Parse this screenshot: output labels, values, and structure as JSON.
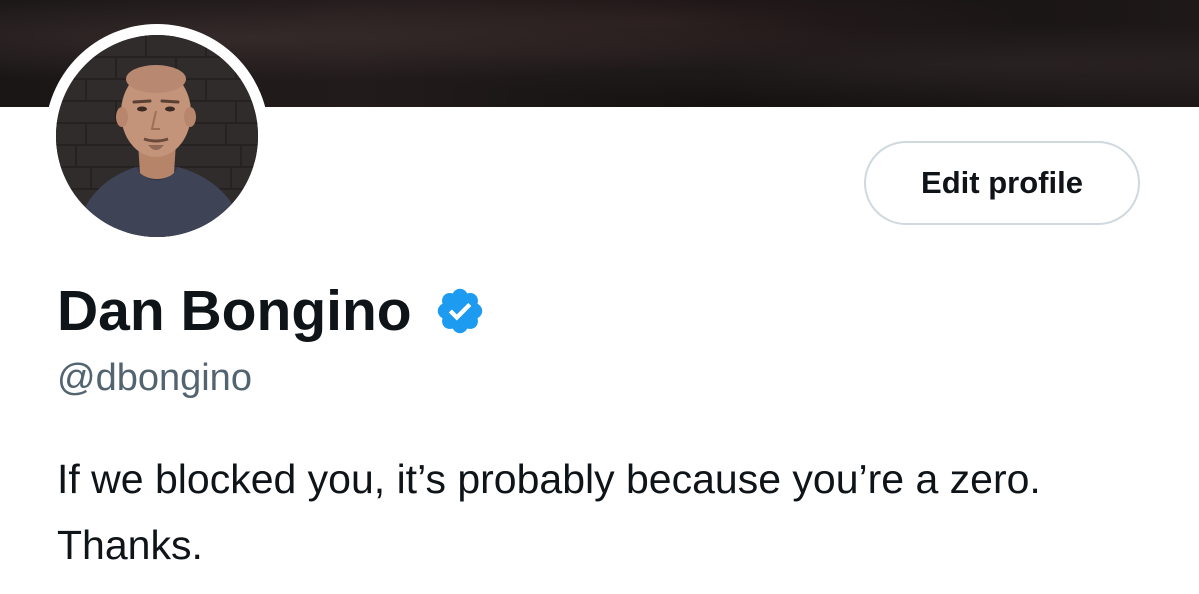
{
  "profile": {
    "display_name": "Dan Bongino",
    "handle": "@dbongino",
    "bio": "If we blocked you, it’s probably because you’re a zero. Thanks.",
    "verified": true
  },
  "actions": {
    "edit_profile_label": "Edit profile"
  },
  "icons": {
    "verified": "verified-badge-icon"
  },
  "colors": {
    "text_primary": "#0f1419",
    "text_secondary": "#536471",
    "verified_blue": "#1d9bf0",
    "button_border": "#cfd9de",
    "banner": "#1a1616"
  }
}
